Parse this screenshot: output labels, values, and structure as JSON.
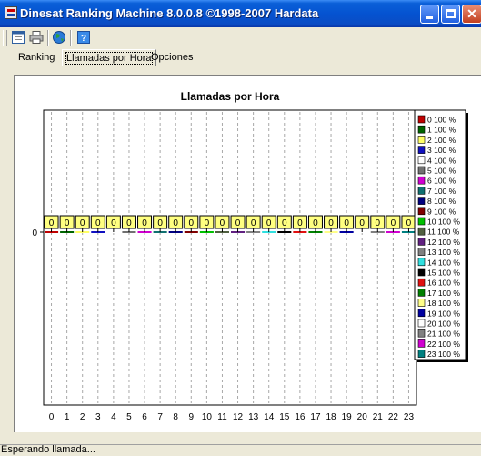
{
  "window": {
    "title": "Dinesat Ranking Machine 8.0.0.8 ©1998-2007 Hardata",
    "close_glyph": "✕"
  },
  "toolbar": {
    "icons": [
      "window-icon",
      "printer-icon",
      "globe-icon",
      "help-icon"
    ]
  },
  "tabs": [
    "Ranking",
    "Llamadas por Hora",
    "Opciones"
  ],
  "status": {
    "text": "Esperando llamada..."
  },
  "chart_data": {
    "type": "bar",
    "title": "Llamadas por Hora",
    "categories": [
      "0",
      "1",
      "2",
      "3",
      "4",
      "5",
      "6",
      "7",
      "8",
      "9",
      "10",
      "11",
      "12",
      "13",
      "14",
      "15",
      "16",
      "17",
      "18",
      "19",
      "20",
      "21",
      "22",
      "23"
    ],
    "values": [
      0,
      0,
      0,
      0,
      0,
      0,
      0,
      0,
      0,
      0,
      0,
      0,
      0,
      0,
      0,
      0,
      0,
      0,
      0,
      0,
      0,
      0,
      0,
      0
    ],
    "data_labels": [
      "0",
      "0",
      "0",
      "0",
      "0",
      "0",
      "0",
      "0",
      "0",
      "0",
      "0",
      "0",
      "0",
      "0",
      "0",
      "0",
      "0",
      "0",
      "0",
      "0",
      "0",
      "0",
      "0",
      "0"
    ],
    "y_ticks": [
      "0"
    ],
    "colors": [
      "#C00000",
      "#006400",
      "#FFFF66",
      "#1010C0",
      "#FFFFFF",
      "#707070",
      "#D000D0",
      "#107070",
      "#000080",
      "#800000",
      "#00C000",
      "#506040",
      "#602080",
      "#808080",
      "#30E0E0",
      "#000000",
      "#E01010",
      "#008000",
      "#FFFF88",
      "#0000A0",
      "#FFFFFF",
      "#808080",
      "#D000D0",
      "#008080"
    ],
    "legend": [
      "0 100 %",
      "1 100 %",
      "2 100 %",
      "3 100 %",
      "4 100 %",
      "5 100 %",
      "6 100 %",
      "7 100 %",
      "8 100 %",
      "9 100 %",
      "10 100 %",
      "11 100 %",
      "12 100 %",
      "13 100 %",
      "14 100 %",
      "15 100 %",
      "16 100 %",
      "17 100 %",
      "18 100 %",
      "19 100 %",
      "20 100 %",
      "21 100 %",
      "22 100 %",
      "23 100 %"
    ],
    "legend_position": "right",
    "grid": true
  }
}
